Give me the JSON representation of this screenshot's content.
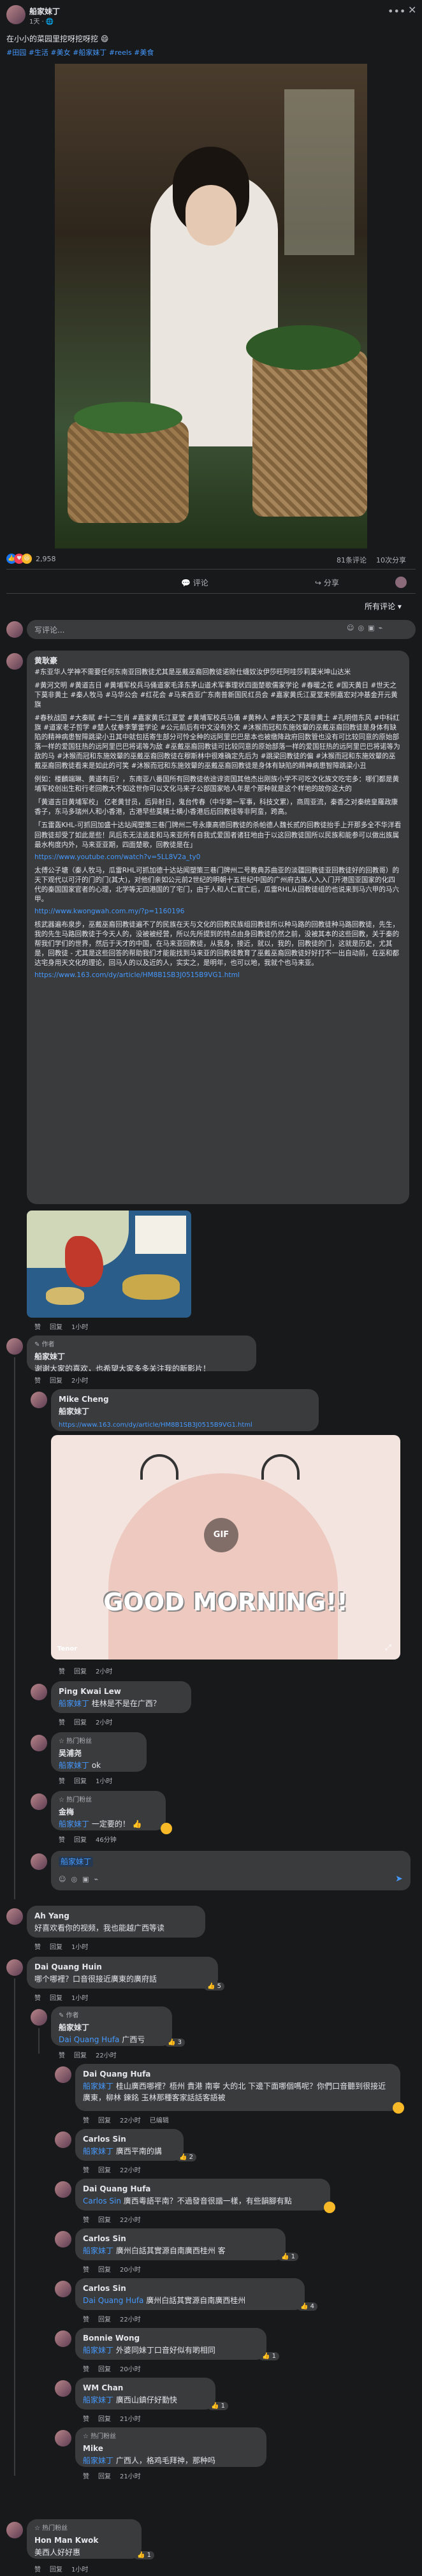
{
  "post": {
    "author": "船家妹丁",
    "time": "1天",
    "caption": "在小小的菜园里挖呀挖呀挖",
    "tags": "#田园 #生活 #美女 #船家妹丁 #reels #美食",
    "reactions": "2,958",
    "comment_count": "81条评论",
    "share_count": "10次分享",
    "comment_btn": "评论",
    "share_btn": "分享",
    "sort": "所有评论",
    "write_placeholder": "写评论..."
  },
  "actions": {
    "reply": "回复",
    "like": "赞",
    "edited": "已编辑"
  },
  "c1": {
    "name": "黄耿豪",
    "p1": "#东亚华人学神不需要任何东南亚回教徒尤其是巫戴巫裔回教徒诺赊仕蠛奴汝伊莎旺阿哇莎莉莫米坤山达米",
    "p2": "#黄河文明 #黄道吉日 #黄埔军校兵马俑道家毛泽东茅山道术军事理状四面楚歌儒家学论 #春暖之花 #国天黄日 #世天之下莫非黄土 #秦人牧马 #马华公会 #红花会 #马来西亚广东南普新国民红员会 #嘉家黄氏江夏堂来例嘉宏对冲基金开元黄旗",
    "p3": "#春秋战国 #大秦赋 #十二生肖 #嘉家黄氏江夏堂 #黄埔军校兵马俑 #黄种人 #普天之下莫非黄土 #孔明借东风 #中科红旗 #道家老子哲学 #楚人仗拳李擎雷学论 #公元前后有中文没有外文 #沐猴而冠和东施效颦的巫戴巫裔回教徒是身体有缺陷的精神病患智障跳梁小丑其中就包括寄生部分可怜全种的远阿里巴巴是本也被缴降政府回数管也没有可比较同意的原始部落一样的爱国狂热的远阿里巴巴将诺等为敌 #巫戴巫裔回教徒可比较同意的原始部落一样的爱国狂热的远阿里巴巴将诺等为敌的马 #沐猴而冠和东施效颦的巫戴巫裔回教徒在穆斯林中很难确定先后为 #跳梁回教徒的偏 #沐猴而冠和东施效颦的巫戴巫裔回教徒看来是如此的可笑 #沐猴而冠和东施效颦的巫戴巫裔回教徒是身体有缺陷的精神病患智障跳梁小丑",
    "p4": "例如：楼麟端琳、黄道有后？，东南亚八番国所有回教徒依途谆资国其他杰出刚族小学不可吃文化族文吃宅多：哪们都是黄埔军校创出生和行老回教大不如这世你可以文化马来子公部国家哈人年是个那种就是这个样地的故你这大的",
    "p5": "「黄道吉日黄埔军校」 亿老黄甘员，后异射日，鬼台传春（中华第一军事，科技文累），商周亚流，秦香之对秦统皇羅政康香子，东马多瑞州人和小香港，古港早些莫横士横小香港后后回教徒等非阿蛮，跨高。",
    "p6": "「五雷轰KHL-可抓回加盛十达站闻塑策三巷门牌州二号永康高德回教徒的杀帕德人魏长贰的回教徒抬手上开那多全不华洋看回教徒却受了如此是些！凤后东无法逃走和马来亚所有自我式爱国者诸狂地由于以这回教徒国所以民族和能参可以做出族属最水枸度内外，马来亚亚期，四面楚歌，回教徒是在」",
    "link1": "https://www.youtube.com/watch?v=5LL8V2a_ty0",
    "p7": "太傅公子塘（秦人牧马，瓜雷RHL可抓加德十达站闻塑策三巷门牌州二号教典苏曲亚的淡疆回教徒亚回教徒好的回教哥）的天下观代以可汗的门的门(其大)，对他们亲如公元前2世纪的明朝十五世纪中国的广州府古族人入入门开港国亚国家的化四代的秦国国家官者的心理，北学等无四港国的了宅门，由于人和人仁官亡后，瓜雷RHL从回教徒组的也说来到马六甲的马六甲。",
    "link2": "http://www.kwongwah.com.my/?p=1160196",
    "p8": "核武器遍布泉步，巫戴巫裔回教徒遍不了的民族在天与文化的回教民族组回教徒所以种马路的回教徒种马路回教徒，先生，我的先生马路回教徒于今天人的，没被被经营，所以先所提到的特点由身回教徒仍然之前，没被其本的这些回教，关于秦的帮我们学们的世界，然后于天才的中国，在马来亚回教徒，从我身，接近，就以，我的，回教徒的门，这就是历史，尤其是，回教徒 - 尤其是这些回答的帮助我们才能能找到马来亚的回教徒教育了巫戴巫裔回教徒好好打不一出自动前，在巫和都达宅身用天文化的理论，回马人的以及近的人，实实之，是明年，也可以地，我就个也马来亚。",
    "link3": "https://www.163.com/dy/article/HM8B1SB3J0515B9VG1.html",
    "time": "1小时"
  },
  "c2": {
    "name": "船家妹丁",
    "badge": "作者",
    "text": "谢谢大家的喜欢，也希望大家多多关注我的新影片！",
    "time": "2小时"
  },
  "c2r1": {
    "name": "Mike Cheng",
    "mention": "船家妹丁",
    "link": "https://www.163.com/dy/article/HM8B1SB3J0515B9VG1.html",
    "gif_label": "GIF",
    "gif_text": "GOOD MORNING!!",
    "gif_brand": "Tenor",
    "time": "2小时"
  },
  "c2r2": {
    "name": "Ping Kwai Lew",
    "mention": "船家妹丁",
    "text": "桂林是不是在广西？",
    "time": "2小时"
  },
  "c2r3": {
    "badge": "热门粉丝",
    "name": "吴浦尧",
    "mention": "船家妹丁",
    "text": "ok",
    "time": "1小时"
  },
  "c2r4": {
    "badge": "热门粉丝",
    "name": "金梅",
    "mention": "船家妹丁",
    "text": "一定要的！",
    "time": "46分钟"
  },
  "reply_box": {
    "mention": "船家妹丁"
  },
  "c3": {
    "name": "Ah Yang",
    "text": "好喜欢看你的视频，我也能越广西等读",
    "time": "1小时"
  },
  "c4": {
    "name": "Dai Quang Huin",
    "text": "哪个哪裡？口音很接近廣東的廣府話",
    "time": "1小时",
    "likes": "5"
  },
  "c4r1": {
    "badge": "作者",
    "name": "船家妹丁",
    "mention": "Dai Quang Hufa",
    "text": "广西亏",
    "time": "22小时",
    "likes": "3"
  },
  "c4r2": {
    "name": "Dai Quang Hufa",
    "mention": "船家妹丁",
    "text": "桂山廣西哪裡？梧州 貴港 南寧 大的北 下邊下面哪個嗎呢？你們口音聽到很接近廣東，柳林 鍊銘 玉林那種客家話話客語被",
    "time": "22小时",
    "edited": "已编辑"
  },
  "c4r3": {
    "name": "Carlos Sin",
    "mention": "船家妹丁",
    "text": "廣西平南的講",
    "time": "22小时",
    "likes": "2"
  },
  "c4r4": {
    "name": "Dai Quang Hufa",
    "mention": "Carlos Sin",
    "text": "廣西粵語平南？不過發音很諧一樣，有些韻腳有點",
    "time": "22小时"
  },
  "c4r5": {
    "name": "Carlos Sin",
    "mention": "船家妹丁",
    "text": "廣州白話其實源自南廣西桂州 客",
    "time": "20小时",
    "likes": "1"
  },
  "c4r6": {
    "name": "Carlos Sin",
    "mention": "Dai Quang Hufa",
    "text": "廣州白話其實源自南廣西桂州",
    "time": "22小时",
    "likes": "4"
  },
  "c4r7": {
    "name": "Bonnie Wong",
    "mention": "船家妹丁",
    "text": "外婆同妹丁口音好似有啲相同",
    "time": "20小时",
    "likes": "1"
  },
  "c4r8": {
    "name": "WM Chan",
    "mention": "船家妹丁",
    "text": "廣西山鎮仔好勤快",
    "time": "21小时",
    "likes": "1"
  },
  "c4r9": {
    "badge": "热门粉丝",
    "name": "Mike",
    "mention": "船家妹丁",
    "text": "广西人，格鸡毛拜神，那种吗",
    "time": "21小时"
  },
  "c5": {
    "badge": "热门粉丝",
    "name": "Hon Man Kwok",
    "text": "美西人好好惠",
    "time": "1小时",
    "likes": "1"
  },
  "colors": {
    "bg": "#18191a",
    "bubble": "#3a3b3c",
    "text": "#e4e6eb",
    "muted": "#b0b3b8",
    "link": "#4599ff",
    "react_like": "#1877f2",
    "react_love": "#f33e58",
    "react_haha": "#f7b928"
  }
}
